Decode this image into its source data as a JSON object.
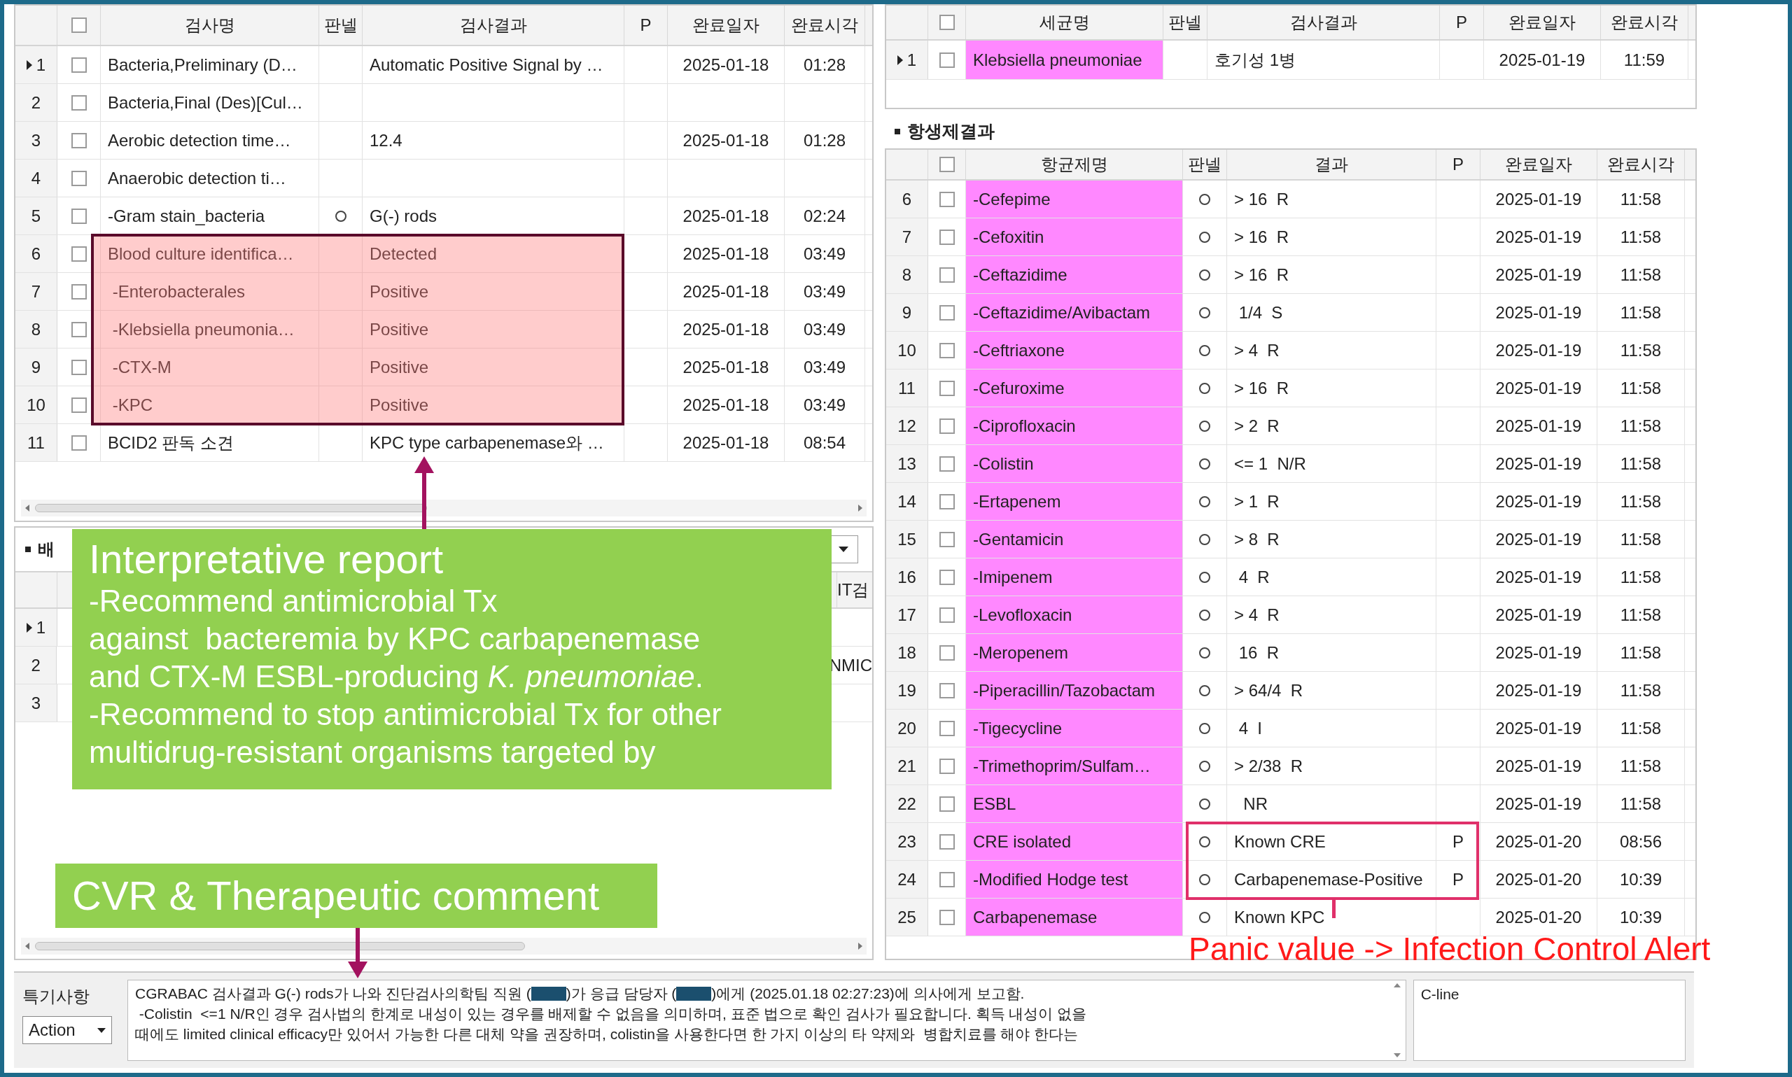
{
  "test_table": {
    "header_checked": false,
    "columns": [
      "검사명",
      "판넬",
      "검사결과",
      "P",
      "완료일자",
      "완료시각"
    ],
    "rows": [
      {
        "index": "1",
        "current": true,
        "checked": false,
        "name": "Bacteria,Preliminary (D…",
        "panel": false,
        "result": "Automatic Positive Signal by …",
        "date": "2025-01-18",
        "time": "01:28",
        "highlighted": false
      },
      {
        "index": "2",
        "current": false,
        "checked": false,
        "name": "Bacteria,Final (Des)[Cul…",
        "panel": false,
        "highlighted": false
      },
      {
        "index": "3",
        "current": false,
        "checked": false,
        "name": "Aerobic detection time…",
        "panel": false,
        "result": "12.4",
        "date": "2025-01-18",
        "time": "01:28",
        "highlighted": false
      },
      {
        "index": "4",
        "current": false,
        "checked": false,
        "name": "Anaerobic detection ti…",
        "panel": false,
        "highlighted": false
      },
      {
        "index": "5",
        "current": false,
        "checked": false,
        "name": "-Gram stain_bacteria",
        "panel": true,
        "result": "G(-) rods",
        "date": "2025-01-18",
        "time": "02:24",
        "highlighted": false
      },
      {
        "index": "6",
        "current": false,
        "checked": false,
        "name": "Blood culture identifica…",
        "panel": false,
        "result": "Detected",
        "date": "2025-01-18",
        "time": "03:49",
        "highlighted": true
      },
      {
        "index": "7",
        "current": false,
        "checked": false,
        "name": " -Enterobacterales",
        "panel": false,
        "result": "Positive",
        "date": "2025-01-18",
        "time": "03:49",
        "highlighted": true
      },
      {
        "index": "8",
        "current": false,
        "checked": false,
        "name": " -Klebsiella pneumonia…",
        "panel": false,
        "result": "Positive",
        "date": "2025-01-18",
        "time": "03:49",
        "highlighted": true
      },
      {
        "index": "9",
        "current": false,
        "checked": false,
        "name": " -CTX-M",
        "panel": false,
        "result": "Positive",
        "date": "2025-01-18",
        "time": "03:49",
        "highlighted": true
      },
      {
        "index": "10",
        "current": false,
        "checked": false,
        "name": " -KPC",
        "panel": false,
        "result": "Positive",
        "date": "2025-01-18",
        "time": "03:49",
        "highlighted": true
      },
      {
        "index": "11",
        "current": false,
        "checked": false,
        "name": "BCID2 판독 소견",
        "panel": false,
        "result": "KPC type carbapenemase와 …",
        "date": "2025-01-18",
        "time": "08:54",
        "highlighted": false
      }
    ]
  },
  "culture_panel": {
    "title": "배",
    "column": "IT검",
    "rows": [
      {
        "index": "1",
        "current": true
      },
      {
        "index": "2",
        "current": false,
        "cell": "NMIC"
      },
      {
        "index": "3",
        "current": false
      }
    ]
  },
  "organism_table": {
    "header_checked": false,
    "columns": [
      "세균명",
      "판넬",
      "검사결과",
      "P",
      "완료일자",
      "완료시각"
    ],
    "rows": [
      {
        "index": "1",
        "current": true,
        "checked": false,
        "name": "Klebsiella pneumoniae",
        "panel": false,
        "result": "호기성 1병",
        "date": "2025-01-19",
        "time": "11:59",
        "highlighted": true,
        "flagged": false
      }
    ]
  },
  "antibiotic_section": {
    "title": "항생제결과"
  },
  "antibiotic_table": {
    "header_checked": false,
    "columns": [
      "항균제명",
      "판넬",
      "결과",
      "P",
      "완료일자",
      "완료시각"
    ],
    "rows": [
      {
        "index": "6",
        "current": false,
        "checked": false,
        "name": "-Cefepime",
        "panel": true,
        "result": "> 16  R",
        "date": "2025-01-19",
        "time": "11:58",
        "highlighted": true,
        "flagged": false
      },
      {
        "index": "7",
        "current": false,
        "checked": false,
        "name": "-Cefoxitin",
        "panel": true,
        "result": "> 16  R",
        "date": "2025-01-19",
        "time": "11:58",
        "highlighted": true,
        "flagged": false
      },
      {
        "index": "8",
        "current": false,
        "checked": false,
        "name": "-Ceftazidime",
        "panel": true,
        "result": "> 16  R",
        "date": "2025-01-19",
        "time": "11:58",
        "highlighted": true,
        "flagged": false
      },
      {
        "index": "9",
        "current": false,
        "checked": false,
        "name": "-Ceftazidime/Avibactam",
        "panel": true,
        "result": " 1/4  S",
        "date": "2025-01-19",
        "time": "11:58",
        "highlighted": true,
        "flagged": false
      },
      {
        "index": "10",
        "current": false,
        "checked": false,
        "name": "-Ceftriaxone",
        "panel": true,
        "result": "> 4  R",
        "date": "2025-01-19",
        "time": "11:58",
        "highlighted": true,
        "flagged": false
      },
      {
        "index": "11",
        "current": false,
        "checked": false,
        "name": "-Cefuroxime",
        "panel": true,
        "result": "> 16  R",
        "date": "2025-01-19",
        "time": "11:58",
        "highlighted": true,
        "flagged": false
      },
      {
        "index": "12",
        "current": false,
        "checked": false,
        "name": "-Ciprofloxacin",
        "panel": true,
        "result": "> 2  R",
        "date": "2025-01-19",
        "time": "11:58",
        "highlighted": true,
        "flagged": false
      },
      {
        "index": "13",
        "current": false,
        "checked": false,
        "name": "-Colistin",
        "panel": true,
        "result": "<= 1  N/R",
        "date": "2025-01-19",
        "time": "11:58",
        "highlighted": true,
        "flagged": false
      },
      {
        "index": "14",
        "current": false,
        "checked": false,
        "name": "-Ertapenem",
        "panel": true,
        "result": "> 1  R",
        "date": "2025-01-19",
        "time": "11:58",
        "highlighted": true,
        "flagged": false
      },
      {
        "index": "15",
        "current": false,
        "checked": false,
        "name": "-Gentamicin",
        "panel": true,
        "result": "> 8  R",
        "date": "2025-01-19",
        "time": "11:58",
        "highlighted": true,
        "flagged": false
      },
      {
        "index": "16",
        "current": false,
        "checked": false,
        "name": "-Imipenem",
        "panel": true,
        "result": " 4  R",
        "date": "2025-01-19",
        "time": "11:58",
        "highlighted": true,
        "flagged": false
      },
      {
        "index": "17",
        "current": false,
        "checked": false,
        "name": "-Levofloxacin",
        "panel": true,
        "result": "> 4  R",
        "date": "2025-01-19",
        "time": "11:58",
        "highlighted": true,
        "flagged": false
      },
      {
        "index": "18",
        "current": false,
        "checked": false,
        "name": "-Meropenem",
        "panel": true,
        "result": " 16  R",
        "date": "2025-01-19",
        "time": "11:58",
        "highlighted": true,
        "flagged": false
      },
      {
        "index": "19",
        "current": false,
        "checked": false,
        "name": "-Piperacillin/Tazobactam",
        "panel": true,
        "result": "> 64/4  R",
        "date": "2025-01-19",
        "time": "11:58",
        "highlighted": true,
        "flagged": false
      },
      {
        "index": "20",
        "current": false,
        "checked": false,
        "name": "-Tigecycline",
        "panel": true,
        "result": " 4  I",
        "date": "2025-01-19",
        "time": "11:58",
        "highlighted": true,
        "flagged": false
      },
      {
        "index": "21",
        "current": false,
        "checked": false,
        "name": "-Trimethoprim/Sulfam…",
        "panel": true,
        "result": "> 2/38  R",
        "date": "2025-01-19",
        "time": "11:58",
        "highlighted": true,
        "flagged": false
      },
      {
        "index": "22",
        "current": false,
        "checked": false,
        "name": "ESBL",
        "panel": true,
        "result": "  NR",
        "date": "2025-01-19",
        "time": "11:58",
        "highlighted": true,
        "flagged": false
      },
      {
        "index": "23",
        "current": false,
        "checked": false,
        "name": "CRE isolated",
        "panel": true,
        "result": "Known CRE",
        "p": "P",
        "date": "2025-01-20",
        "time": "08:56",
        "highlighted": true,
        "flagged": true
      },
      {
        "index": "24",
        "current": false,
        "checked": false,
        "name": "-Modified Hodge test",
        "panel": true,
        "result": "Carbapenemase-Positive",
        "p": "P",
        "date": "2025-01-20",
        "time": "10:39",
        "highlighted": true,
        "flagged": true
      },
      {
        "index": "25",
        "current": false,
        "checked": false,
        "name": "Carbapenemase",
        "panel": true,
        "result": "Known KPC",
        "date": "2025-01-20",
        "time": "10:39",
        "highlighted": true,
        "flagged": false
      }
    ]
  },
  "interpretative_callout": {
    "title": "Interpretative report",
    "lines": [
      "-Recommend antimicrobial Tx",
      "against  bacteremia by KPC carbapenemase",
      "and CTX-M ESBL-producing *K. pneumoniae*.",
      "-Recommend to stop antimicrobial Tx for other",
      "multidrug-resistant organisms targeted by"
    ]
  },
  "cvr_callout": {
    "title": "CVR & Therapeutic comment"
  },
  "panic_callout": {
    "text": "Panic value -> Infection Control Alert"
  },
  "remarks": {
    "label": "특기사항",
    "action": "Action",
    "lines": [
      [
        {
          "kind": "text",
          "text": "CGRABAC 검사결과 G(-) rods가 나와 진단검사의학팀 직원 ("
        },
        {
          "kind": "redacted"
        },
        {
          "kind": "text",
          "text": ")가 응급 담당자 ("
        },
        {
          "kind": "redacted"
        },
        {
          "kind": "text",
          "text": ")에게 (2025.01.18 02:27:23)에 의사에게 보고함."
        }
      ],
      [
        {
          "kind": "text",
          "text": " -Colistin  <=1 N/R인 경우 검사법의 한계로 내성이 있는 경우를 배제할 수 없음을 의미하며, 표준 법으로 확인 검사가 필요합니다. 획득 내성이 없을"
        }
      ],
      [
        {
          "kind": "text",
          "text": "때에도 limited clinical efficacy만 있어서 가능한 다른 대체 약을 권장하며, colistin을 사용한다면 한 가지 이상의 타 약제와  병합치료를 해야 한다는"
        }
      ]
    ],
    "side_value": "C-line"
  }
}
